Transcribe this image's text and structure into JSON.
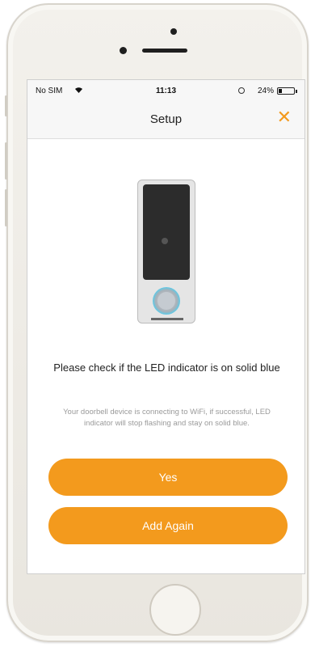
{
  "status_bar": {
    "carrier": "No SIM",
    "time": "11:13",
    "battery": "24%",
    "battery_level": 0.24
  },
  "nav": {
    "title": "Setup",
    "close_glyph": "✕"
  },
  "main": {
    "instruction": "Please check if the LED indicator is on solid blue",
    "description": "Your doorbell device is connecting to WiFi, if successful, LED indicator will stop flashing and stay on solid blue."
  },
  "buttons": {
    "yes_label": "Yes",
    "add_again_label": "Add Again"
  },
  "colors": {
    "accent": "#f39a1d"
  },
  "icons": [
    "wifi-icon",
    "alarm-icon",
    "battery-icon",
    "close-icon"
  ]
}
